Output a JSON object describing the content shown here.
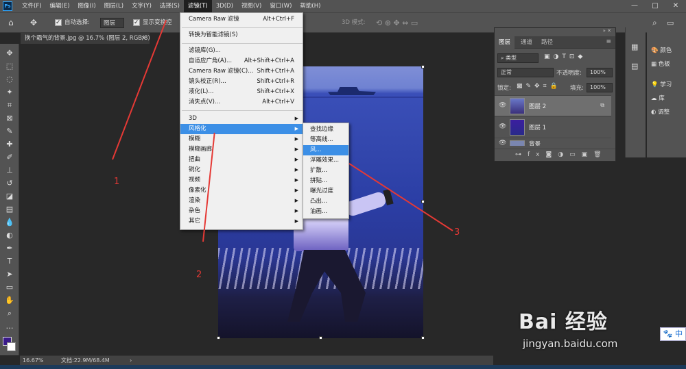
{
  "app": {
    "logo": "Ps",
    "menus": [
      "文件(F)",
      "编辑(E)",
      "图像(I)",
      "图层(L)",
      "文字(Y)",
      "选择(S)",
      "滤镜(T)",
      "3D(D)",
      "视图(V)",
      "窗口(W)",
      "帮助(H)"
    ],
    "active_menu_index": 6,
    "window_controls": [
      "—",
      "□",
      "✕"
    ]
  },
  "options_bar": {
    "home_icon": "home-icon",
    "move_icon": "move-icon",
    "auto_select_label": "自动选择:",
    "auto_select_value": "图层",
    "show_transform_label": "显示变换控",
    "mode_3d_label": "3D 模式:",
    "search_icon": "search-icon"
  },
  "document_tab": {
    "title": "换个霸气的背景.jpg @ 16.7% (图层 2, RGB/8) *",
    "close": "×"
  },
  "filter_menu": {
    "items": [
      {
        "label": "Camera Raw 滤镜",
        "shortcut": "Alt+Ctrl+F"
      },
      {
        "label": "转换为智能滤镜(S)",
        "shortcut": ""
      },
      {
        "label": "滤镜库(G)...",
        "shortcut": ""
      },
      {
        "label": "自适应广角(A)...",
        "shortcut": "Alt+Shift+Ctrl+A"
      },
      {
        "label": "Camera Raw 滤镜(C)...",
        "shortcut": "Shift+Ctrl+A"
      },
      {
        "label": "镜头校正(R)...",
        "shortcut": "Shift+Ctrl+R"
      },
      {
        "label": "液化(L)...",
        "shortcut": "Shift+Ctrl+X"
      },
      {
        "label": "消失点(V)...",
        "shortcut": "Alt+Ctrl+V"
      },
      {
        "label": "3D",
        "shortcut": ""
      },
      {
        "label": "风格化",
        "shortcut": ""
      },
      {
        "label": "模糊",
        "shortcut": ""
      },
      {
        "label": "模糊画廊",
        "shortcut": ""
      },
      {
        "label": "扭曲",
        "shortcut": ""
      },
      {
        "label": "锐化",
        "shortcut": ""
      },
      {
        "label": "视频",
        "shortcut": ""
      },
      {
        "label": "像素化",
        "shortcut": ""
      },
      {
        "label": "渲染",
        "shortcut": ""
      },
      {
        "label": "杂色",
        "shortcut": ""
      },
      {
        "label": "其它",
        "shortcut": ""
      }
    ],
    "highlighted": "风格化"
  },
  "stylize_submenu": {
    "items": [
      "查找边缘",
      "等高线...",
      "风...",
      "浮雕效果...",
      "扩散...",
      "拼贴...",
      "曝光过度",
      "凸出...",
      "油画..."
    ],
    "highlighted": "风..."
  },
  "layers_panel": {
    "tabs": [
      "图层",
      "通道",
      "路径"
    ],
    "filter_kind": "类型",
    "blend_mode": "正常",
    "opacity_label": "不透明度:",
    "opacity_value": "100%",
    "lock_label": "锁定:",
    "fill_label": "填充:",
    "fill_value": "100%",
    "layers": [
      {
        "name": "图层 2",
        "selected": true
      },
      {
        "name": "图层 1",
        "selected": false
      },
      {
        "name": "背景",
        "selected": false
      }
    ]
  },
  "right_panel": {
    "items": [
      "颜色",
      "色板",
      "学习",
      "库",
      "调整"
    ]
  },
  "status_bar": {
    "zoom": "16.67%",
    "doc_info": "文档:22.9M/68.4M"
  },
  "annotations": {
    "labels": [
      "1",
      "2",
      "3"
    ],
    "color": "#e53935"
  },
  "watermark": {
    "brand": "Bai 经验",
    "url": "jingyan.baidu.com"
  },
  "ime": {
    "label": "中"
  }
}
